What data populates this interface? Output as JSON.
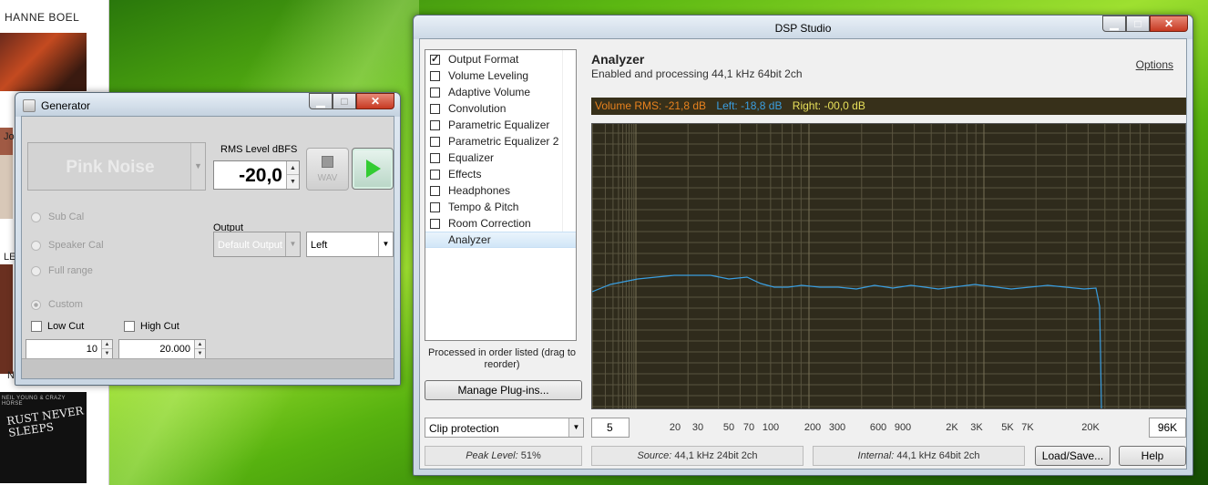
{
  "desktop": {
    "album_title": "HANNE BOEL",
    "cover_text": "RUST NEVER SLEEPS",
    "cover_top_text": "NEIL YOUNG & CRAZY HORSE",
    "side_labels": [
      "Jo",
      "LE",
      "N"
    ]
  },
  "generator": {
    "title": "Generator",
    "noise_type": "Pink Noise",
    "rms_label": "RMS Level dBFS",
    "rms_value": "-20,0",
    "wav_label": "WAV",
    "radio_options": [
      "Sub Cal",
      "Speaker Cal",
      "Full range",
      "Custom"
    ],
    "selected_radio": "Custom",
    "output_label": "Output",
    "output_device": "Default Output",
    "channel": "Left",
    "low_cut_label": "Low Cut",
    "high_cut_label": "High Cut",
    "low_cut_value": "10",
    "high_cut_value": "20.000"
  },
  "dsp": {
    "title": "DSP Studio",
    "plugins": [
      {
        "label": "Output Format",
        "checked": true
      },
      {
        "label": "Volume Leveling",
        "checked": false
      },
      {
        "label": "Adaptive Volume",
        "checked": false
      },
      {
        "label": "Convolution",
        "checked": false
      },
      {
        "label": "Parametric Equalizer",
        "checked": false
      },
      {
        "label": "Parametric Equalizer 2",
        "checked": false
      },
      {
        "label": "Equalizer",
        "checked": false
      },
      {
        "label": "Effects",
        "checked": false
      },
      {
        "label": "Headphones",
        "checked": false
      },
      {
        "label": "Tempo & Pitch",
        "checked": false
      },
      {
        "label": "Room Correction",
        "checked": false
      }
    ],
    "selected_item": "Analyzer",
    "order_note": "Processed in order listed (drag to reorder)",
    "manage_button": "Manage Plug-ins...",
    "clip_select": "Clip protection",
    "analyzer_title": "Analyzer",
    "analyzer_subtitle": "Enabled and processing 44,1 kHz 64bit 2ch",
    "options_link": "Options",
    "volume": {
      "rms": "Volume RMS: -21,8 dB",
      "left": "Left: -18,8 dB",
      "right": "Right: -00,0 dB",
      "rms_color": "#e8821e",
      "left_color": "#3a9ee0",
      "right_color": "#e8e05a"
    },
    "freq_min": "5",
    "freq_labels": [
      "20",
      "30",
      "50",
      "70",
      "100",
      "200",
      "300",
      "600",
      "900",
      "2K",
      "3K",
      "5K",
      "7K",
      "20K"
    ],
    "freq_max": "96K",
    "peak_level_label": "Peak Level:",
    "peak_level_value": "51%",
    "source_label": "Source:",
    "source_value": "44,1 kHz 24bit 2ch",
    "internal_label": "Internal:",
    "internal_value": "44,1 kHz 64bit 2ch",
    "load_save_button": "Load/Save...",
    "help_button": "Help"
  }
}
